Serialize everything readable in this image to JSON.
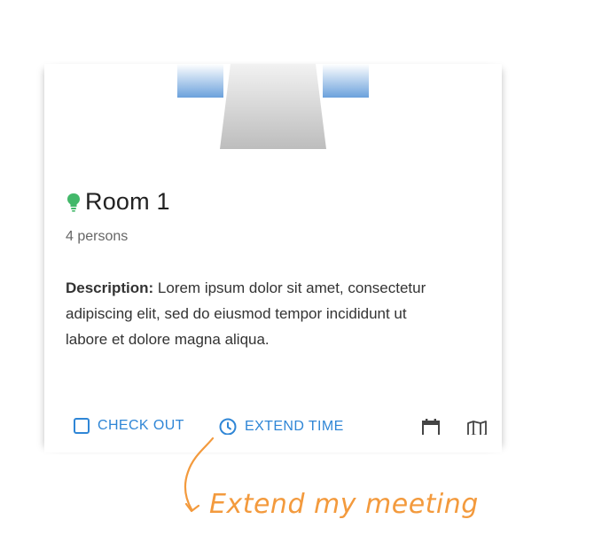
{
  "room": {
    "name": "Room 1",
    "capacity": "4 persons",
    "status_color": "#43b86a"
  },
  "description": {
    "label": "Description:",
    "text": " Lorem ipsum dolor sit amet, consectetur adipiscing elit, sed do eiusmod tempor incididunt ut labore et dolore magna aliqua."
  },
  "actions": {
    "checkout_label": "CHECK OUT",
    "extend_label": "EXTEND TIME",
    "accent_color": "#2f86d6"
  },
  "icons": {
    "checkout": "checkbox-outline-icon",
    "extend": "clock-icon",
    "calendar": "calendar-icon",
    "map": "map-icon",
    "status": "lightbulb-icon"
  },
  "annotation": {
    "text": "Extend my meeting",
    "color": "#f39a3d"
  }
}
